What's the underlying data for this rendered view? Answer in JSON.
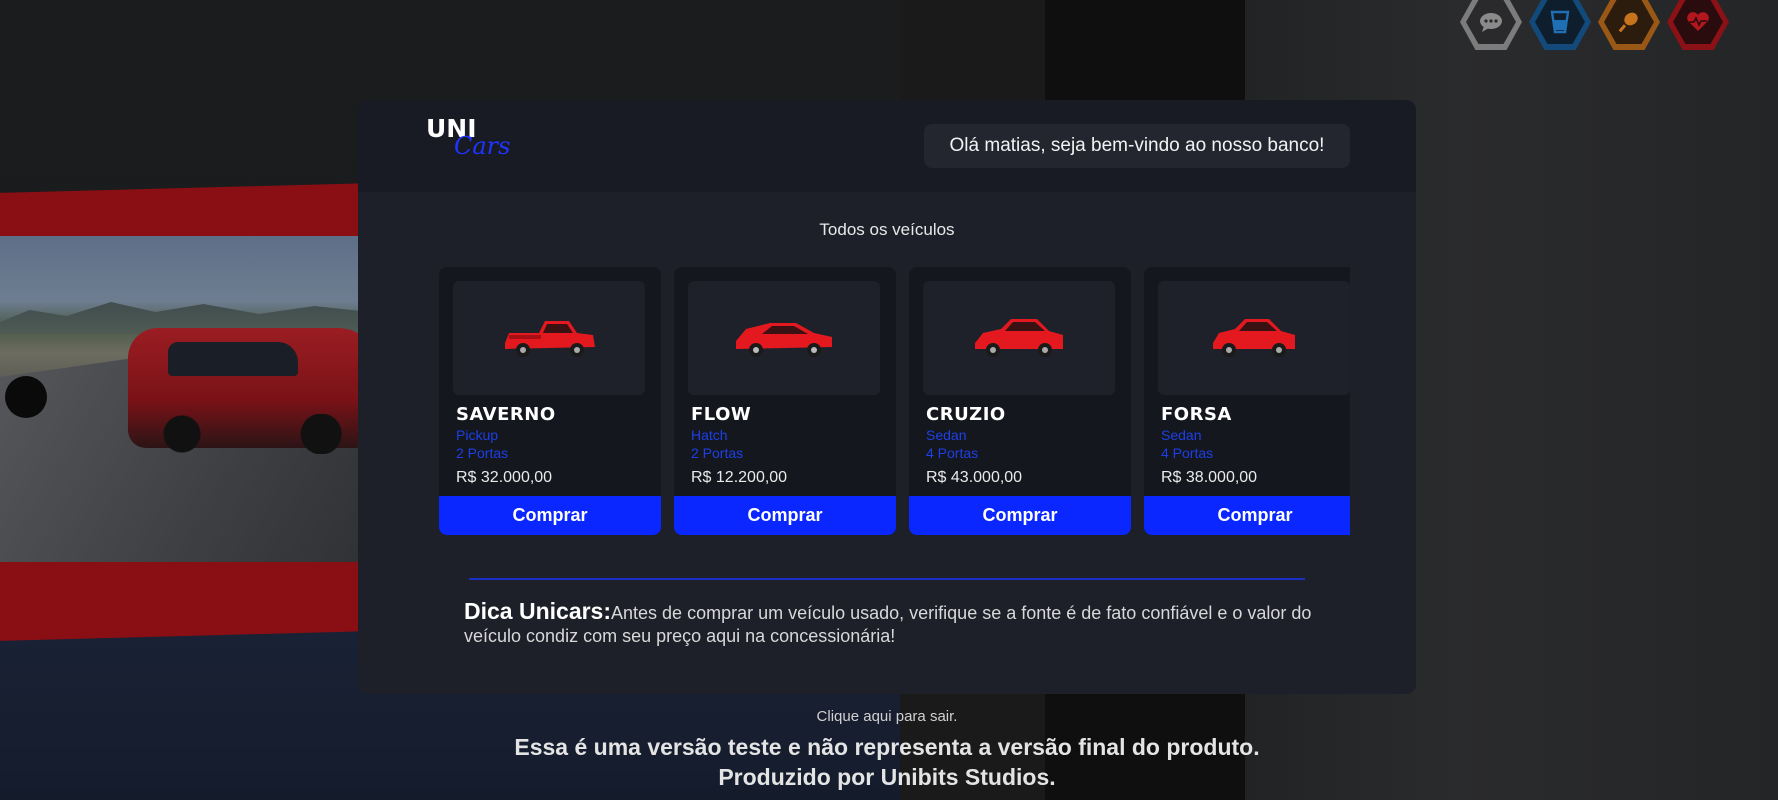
{
  "brand": {
    "logo_top": "UNI",
    "logo_bottom": "Cars"
  },
  "header": {
    "welcome": "Olá matias, seja bem-vindo ao nosso banco!"
  },
  "section_title": "Todos os veículos",
  "vehicles": [
    {
      "name": "SAVERNO",
      "type": "Pickup",
      "doors": "2 Portas",
      "price": "R$ 32.000,00",
      "buy_label": "Comprar",
      "image_icon": "red-pickup-car-icon"
    },
    {
      "name": "FLOW",
      "type": "Hatch",
      "doors": "2 Portas",
      "price": "R$ 12.200,00",
      "buy_label": "Comprar",
      "image_icon": "red-hatch-car-icon"
    },
    {
      "name": "CRUZIO",
      "type": "Sedan",
      "doors": "4 Portas",
      "price": "R$ 43.000,00",
      "buy_label": "Comprar",
      "image_icon": "red-sedan-car-icon"
    },
    {
      "name": "FORSA",
      "type": "Sedan",
      "doors": "4 Portas",
      "price": "R$ 38.000,00",
      "buy_label": "Comprar",
      "image_icon": "red-sedan-car-icon"
    }
  ],
  "tip": {
    "label": "Dica Unicars:",
    "text": "Antes de comprar um veículo usado, verifique se a fonte é de fato confiável e o valor do veículo condiz com seu preço aqui na concessionária!"
  },
  "footer": {
    "exit": "Clique aqui para sair.",
    "disclaimer": "Essa é uma versão teste e não representa a versão final do produto.",
    "credit": "Produzido por Unibits Studios."
  },
  "hud": [
    {
      "icon": "chat-bubble-icon",
      "color": "#8a8a8a"
    },
    {
      "icon": "water-cup-icon",
      "color": "#1f6fb5"
    },
    {
      "icon": "food-drumstick-icon",
      "color": "#c7731b"
    },
    {
      "icon": "heart-health-icon",
      "color": "#b3161d"
    }
  ],
  "colors": {
    "accent": "#0a27ff",
    "panel": "#1d2029",
    "vehicle_meta": "#1e3fe6"
  }
}
